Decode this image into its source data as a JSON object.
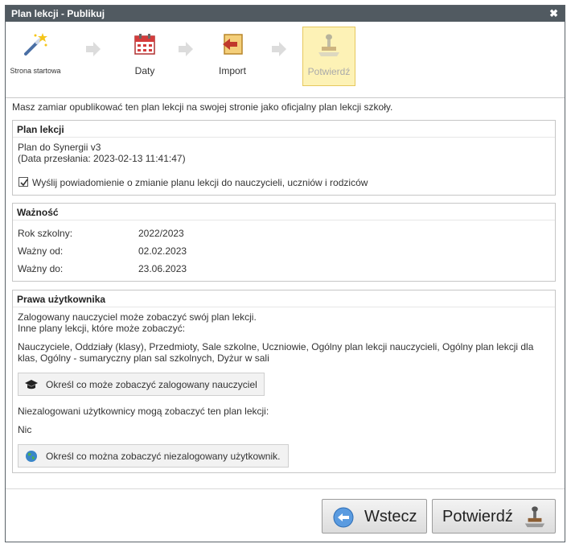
{
  "window": {
    "title": "Plan lekcji - Publikuj",
    "close_label": "✖"
  },
  "wizard": {
    "steps": [
      {
        "label": "Strona startowa",
        "icon": "magic-wand-icon",
        "active": false
      },
      {
        "label": "Daty",
        "icon": "calendar-icon",
        "active": false
      },
      {
        "label": "Import",
        "icon": "import-icon",
        "active": false
      },
      {
        "label": "Potwierdź",
        "icon": "stamp-icon",
        "active": true
      }
    ]
  },
  "intro": "Masz zamiar opublikować ten plan lekcji na swojej stronie jako oficjalny plan lekcji szkoły.",
  "plan": {
    "title": "Plan lekcji",
    "name": "Plan do Synergii v3",
    "date_line": "(Data przesłania: 2023-02-13 11:41:47)",
    "notify_label": "Wyślij powiadomienie o zmianie planu lekcji do nauczycieli, uczniów i rodziców",
    "notify_checked": true
  },
  "validity": {
    "title": "Ważność",
    "rows": [
      {
        "label": "Rok szkolny:",
        "value": "2022/2023"
      },
      {
        "label": "Ważny od:",
        "value": "02.02.2023"
      },
      {
        "label": "Ważny do:",
        "value": "23.06.2023"
      }
    ]
  },
  "rights": {
    "title": "Prawa użytkownika",
    "logged_line1": "Zalogowany nauczyciel może zobaczyć swój plan lekcji.",
    "logged_line2": "Inne plany lekcji, które może zobaczyć:",
    "list_line1": "Nauczyciele, Oddziały (klasy), Przedmioty, Sale szkolne, Uczniowie, Ogólny plan lekcji nauczycieli, Ogólny plan lekcji dla",
    "list_line2": "klas, Ogólny - sumaryczny plan sal szkolnych, Dyżur w sali",
    "logged_button": "Określ co może zobaczyć zalogowany nauczyciel",
    "anon_line": "Niezalogowani użytkownicy mogą zobaczyć ten plan lekcji:",
    "anon_value": "Nic",
    "anon_button": "Określ co można zobaczyć niezalogowany użytkownik."
  },
  "footer": {
    "back_label": "Wstecz",
    "confirm_label": "Potwierdź"
  },
  "colors": {
    "titlebar": "#515a61",
    "active_step": "#fdf2b6",
    "active_border": "#e6c85e"
  }
}
